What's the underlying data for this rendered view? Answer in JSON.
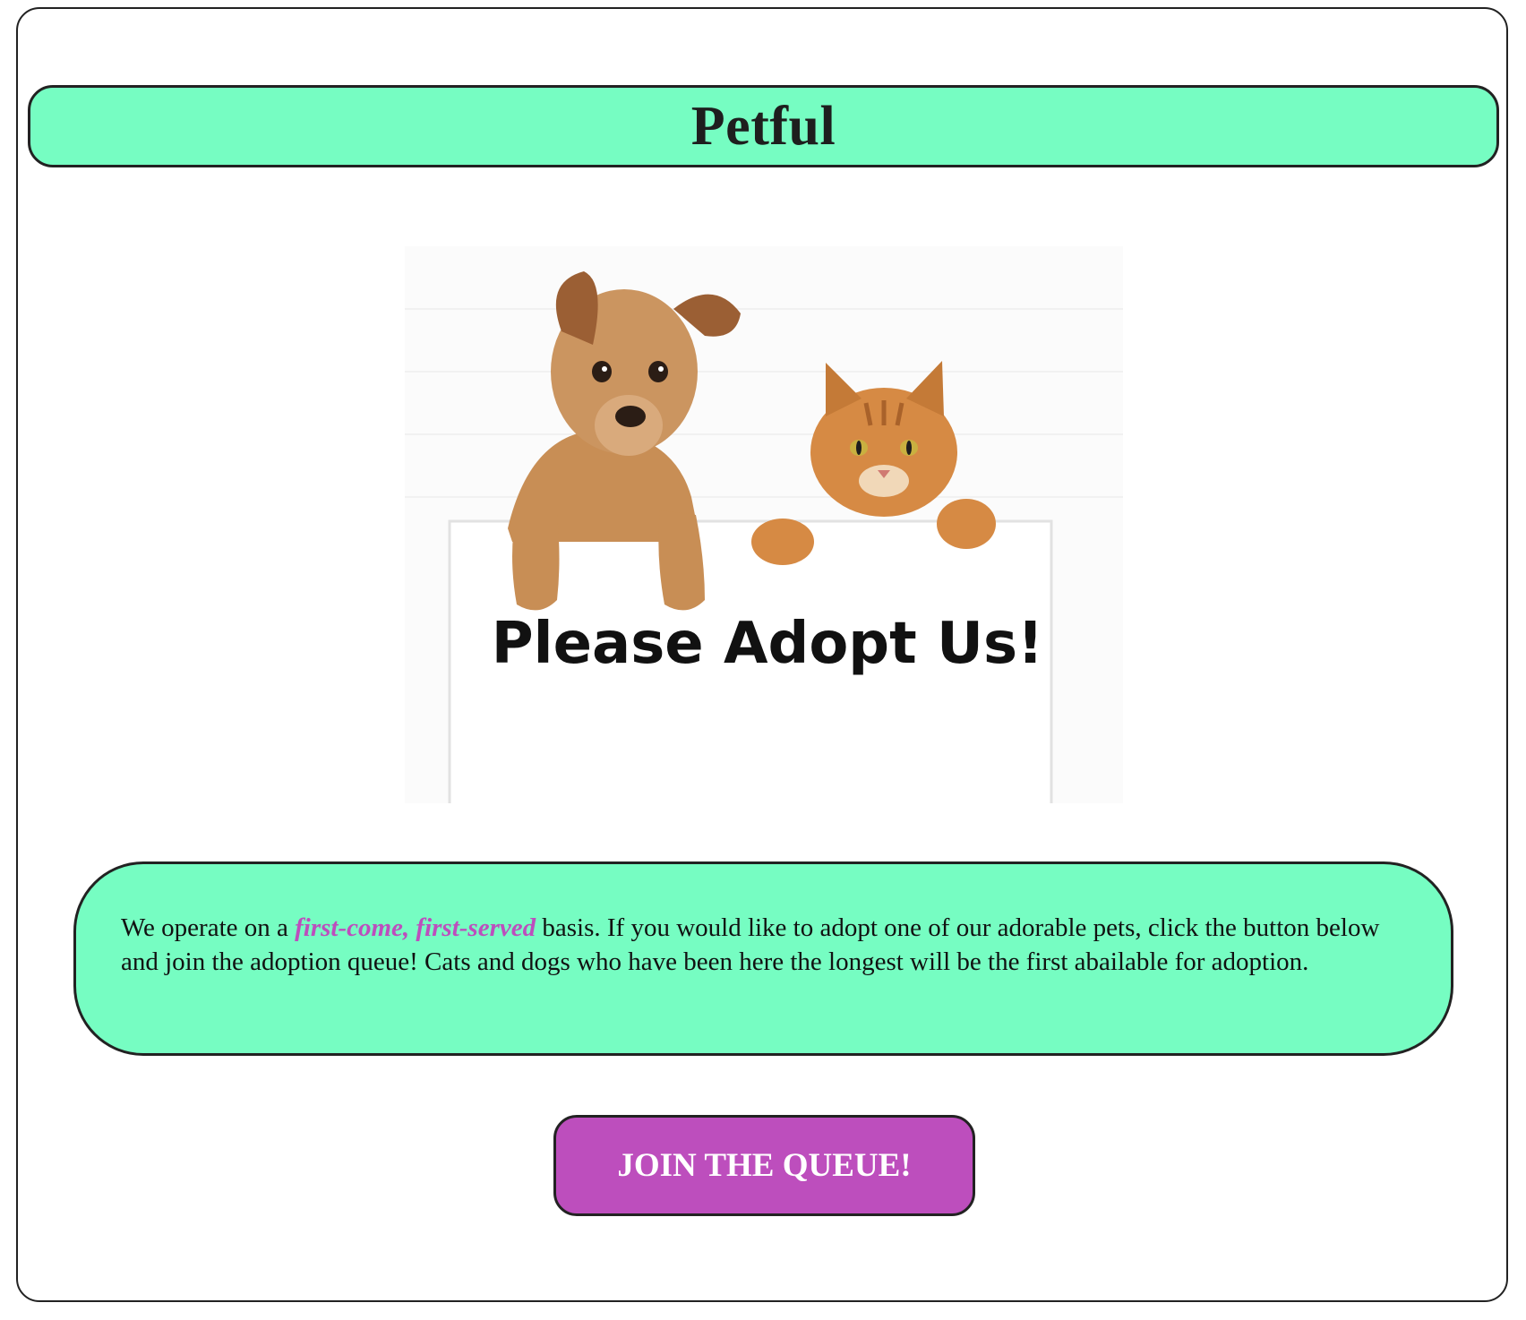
{
  "header": {
    "title": "Petful"
  },
  "hero": {
    "sign_text": "Please Adopt Us!",
    "image_name": "dog-and-cat-adopt-image"
  },
  "info": {
    "text_before": "We operate on a ",
    "emphasis": "first-come, first-served",
    "text_after": " basis. If you would like to adopt one of our adorable pets, click the button below and join the adoption queue! Cats and dogs who have been here the longest will be the first abailable for adoption."
  },
  "actions": {
    "join_label": "JOIN THE QUEUE!"
  },
  "colors": {
    "accent_green": "#76fdc2",
    "accent_purple": "#bd4ebd",
    "border": "#222222"
  }
}
